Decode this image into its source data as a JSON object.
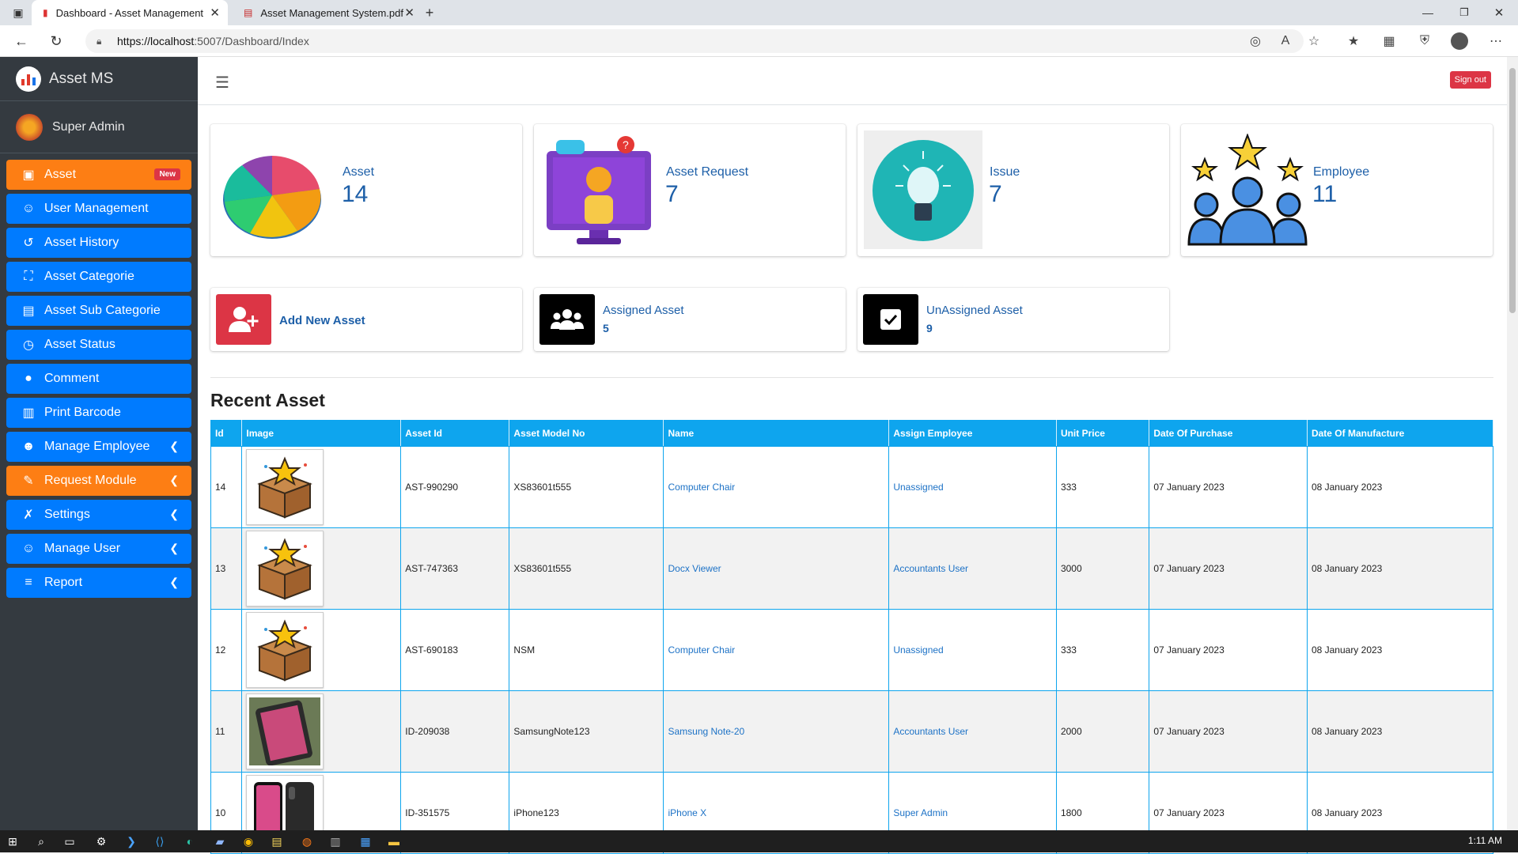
{
  "browser": {
    "tabs": [
      {
        "title": "Dashboard - Asset Management",
        "active": true
      },
      {
        "title": "Asset Management System.pdf",
        "active": false
      }
    ],
    "url_host": "https://localhost",
    "url_rest": ":5007/Dashboard/Index"
  },
  "sidebar": {
    "brand": "Asset MS",
    "user": "Super Admin",
    "items": [
      {
        "label": "Asset",
        "icon": "box-icon",
        "badge": "New",
        "color": "orange"
      },
      {
        "label": "User Management",
        "icon": "users-cog-icon",
        "color": "blue"
      },
      {
        "label": "Asset History",
        "icon": "history-icon",
        "color": "blue"
      },
      {
        "label": "Asset Categorie",
        "icon": "expand-icon",
        "color": "blue"
      },
      {
        "label": "Asset Sub Categorie",
        "icon": "id-card-icon",
        "color": "blue"
      },
      {
        "label": "Asset Status",
        "icon": "clock-icon",
        "color": "blue"
      },
      {
        "label": "Comment",
        "icon": "comment-icon",
        "color": "blue"
      },
      {
        "label": "Print Barcode",
        "icon": "barcode-icon",
        "color": "blue"
      },
      {
        "label": "Manage Employee",
        "icon": "users-icon",
        "color": "blue",
        "chevron": true
      },
      {
        "label": "Request Module",
        "icon": "user-edit-icon",
        "color": "orange",
        "chevron": true
      },
      {
        "label": "Settings",
        "icon": "tools-icon",
        "color": "blue",
        "chevron": true
      },
      {
        "label": "Manage User",
        "icon": "user-cog-icon",
        "color": "blue",
        "chevron": true
      },
      {
        "label": "Report",
        "icon": "database-icon",
        "color": "blue",
        "chevron": true
      }
    ]
  },
  "header": {
    "signout": "Sign out"
  },
  "stats": [
    {
      "label": "Asset",
      "value": "14"
    },
    {
      "label": "Asset Request",
      "value": "7"
    },
    {
      "label": "Issue",
      "value": "7"
    },
    {
      "label": "Employee",
      "value": "11"
    }
  ],
  "quick": {
    "add_new": "Add New Asset",
    "assigned_label": "Assigned Asset",
    "assigned_value": "5",
    "unassigned_label": "UnAssigned Asset",
    "unassigned_value": "9"
  },
  "recent": {
    "title": "Recent Asset",
    "columns": [
      "Id",
      "Image",
      "Asset Id",
      "Asset Model No",
      "Name",
      "Assign Employee",
      "Unit Price",
      "Date Of Purchase",
      "Date Of Manufacture"
    ],
    "rows": [
      {
        "id": "14",
        "image": "box-star",
        "asset_id": "AST-990290",
        "model": "XS83601t555",
        "name": "Computer Chair",
        "employee": "Unassigned",
        "price": "333",
        "purchase": "07 January 2023",
        "manufacture": "08 January 2023"
      },
      {
        "id": "13",
        "image": "box-star",
        "asset_id": "AST-747363",
        "model": "XS83601t555",
        "name": "Docx Viewer",
        "employee": "Accountants User",
        "price": "3000",
        "purchase": "07 January 2023",
        "manufacture": "08 January 2023"
      },
      {
        "id": "12",
        "image": "box-star",
        "asset_id": "AST-690183",
        "model": "NSM",
        "name": "Computer Chair",
        "employee": "Unassigned",
        "price": "333",
        "purchase": "07 January 2023",
        "manufacture": "08 January 2023"
      },
      {
        "id": "11",
        "image": "phone-photo",
        "asset_id": "ID-209038",
        "model": "SamsungNote123",
        "name": "Samsung Note-20",
        "employee": "Accountants User",
        "price": "2000",
        "purchase": "07 January 2023",
        "manufacture": "08 January 2023"
      },
      {
        "id": "10",
        "image": "iphone-photo",
        "asset_id": "ID-351575",
        "model": "iPhone123",
        "name": "iPhone X",
        "employee": "Super Admin",
        "price": "1800",
        "purchase": "07 January 2023",
        "manufacture": "08 January 2023"
      }
    ]
  },
  "taskbar": {
    "clock": "1:11 AM"
  },
  "colors": {
    "primary": "#007bff",
    "orange": "#fd7e14",
    "danger": "#dc3545",
    "table_header": "#0ea5ee",
    "sidebar": "#343a40"
  }
}
